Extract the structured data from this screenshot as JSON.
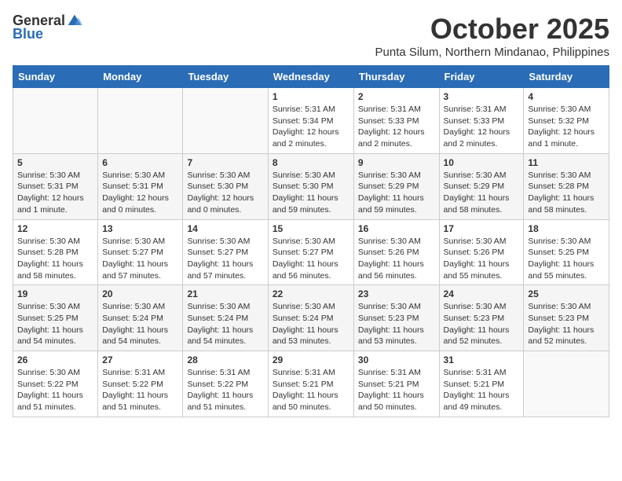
{
  "logo": {
    "general": "General",
    "blue": "Blue"
  },
  "title": "October 2025",
  "subtitle": "Punta Silum, Northern Mindanao, Philippines",
  "days_of_week": [
    "Sunday",
    "Monday",
    "Tuesday",
    "Wednesday",
    "Thursday",
    "Friday",
    "Saturday"
  ],
  "weeks": [
    [
      {
        "day": "",
        "info": ""
      },
      {
        "day": "",
        "info": ""
      },
      {
        "day": "",
        "info": ""
      },
      {
        "day": "1",
        "info": "Sunrise: 5:31 AM\nSunset: 5:34 PM\nDaylight: 12 hours and 2 minutes."
      },
      {
        "day": "2",
        "info": "Sunrise: 5:31 AM\nSunset: 5:33 PM\nDaylight: 12 hours and 2 minutes."
      },
      {
        "day": "3",
        "info": "Sunrise: 5:31 AM\nSunset: 5:33 PM\nDaylight: 12 hours and 2 minutes."
      },
      {
        "day": "4",
        "info": "Sunrise: 5:30 AM\nSunset: 5:32 PM\nDaylight: 12 hours and 1 minute."
      }
    ],
    [
      {
        "day": "5",
        "info": "Sunrise: 5:30 AM\nSunset: 5:31 PM\nDaylight: 12 hours and 1 minute."
      },
      {
        "day": "6",
        "info": "Sunrise: 5:30 AM\nSunset: 5:31 PM\nDaylight: 12 hours and 0 minutes."
      },
      {
        "day": "7",
        "info": "Sunrise: 5:30 AM\nSunset: 5:30 PM\nDaylight: 12 hours and 0 minutes."
      },
      {
        "day": "8",
        "info": "Sunrise: 5:30 AM\nSunset: 5:30 PM\nDaylight: 11 hours and 59 minutes."
      },
      {
        "day": "9",
        "info": "Sunrise: 5:30 AM\nSunset: 5:29 PM\nDaylight: 11 hours and 59 minutes."
      },
      {
        "day": "10",
        "info": "Sunrise: 5:30 AM\nSunset: 5:29 PM\nDaylight: 11 hours and 58 minutes."
      },
      {
        "day": "11",
        "info": "Sunrise: 5:30 AM\nSunset: 5:28 PM\nDaylight: 11 hours and 58 minutes."
      }
    ],
    [
      {
        "day": "12",
        "info": "Sunrise: 5:30 AM\nSunset: 5:28 PM\nDaylight: 11 hours and 58 minutes."
      },
      {
        "day": "13",
        "info": "Sunrise: 5:30 AM\nSunset: 5:27 PM\nDaylight: 11 hours and 57 minutes."
      },
      {
        "day": "14",
        "info": "Sunrise: 5:30 AM\nSunset: 5:27 PM\nDaylight: 11 hours and 57 minutes."
      },
      {
        "day": "15",
        "info": "Sunrise: 5:30 AM\nSunset: 5:27 PM\nDaylight: 11 hours and 56 minutes."
      },
      {
        "day": "16",
        "info": "Sunrise: 5:30 AM\nSunset: 5:26 PM\nDaylight: 11 hours and 56 minutes."
      },
      {
        "day": "17",
        "info": "Sunrise: 5:30 AM\nSunset: 5:26 PM\nDaylight: 11 hours and 55 minutes."
      },
      {
        "day": "18",
        "info": "Sunrise: 5:30 AM\nSunset: 5:25 PM\nDaylight: 11 hours and 55 minutes."
      }
    ],
    [
      {
        "day": "19",
        "info": "Sunrise: 5:30 AM\nSunset: 5:25 PM\nDaylight: 11 hours and 54 minutes."
      },
      {
        "day": "20",
        "info": "Sunrise: 5:30 AM\nSunset: 5:24 PM\nDaylight: 11 hours and 54 minutes."
      },
      {
        "day": "21",
        "info": "Sunrise: 5:30 AM\nSunset: 5:24 PM\nDaylight: 11 hours and 54 minutes."
      },
      {
        "day": "22",
        "info": "Sunrise: 5:30 AM\nSunset: 5:24 PM\nDaylight: 11 hours and 53 minutes."
      },
      {
        "day": "23",
        "info": "Sunrise: 5:30 AM\nSunset: 5:23 PM\nDaylight: 11 hours and 53 minutes."
      },
      {
        "day": "24",
        "info": "Sunrise: 5:30 AM\nSunset: 5:23 PM\nDaylight: 11 hours and 52 minutes."
      },
      {
        "day": "25",
        "info": "Sunrise: 5:30 AM\nSunset: 5:23 PM\nDaylight: 11 hours and 52 minutes."
      }
    ],
    [
      {
        "day": "26",
        "info": "Sunrise: 5:30 AM\nSunset: 5:22 PM\nDaylight: 11 hours and 51 minutes."
      },
      {
        "day": "27",
        "info": "Sunrise: 5:31 AM\nSunset: 5:22 PM\nDaylight: 11 hours and 51 minutes."
      },
      {
        "day": "28",
        "info": "Sunrise: 5:31 AM\nSunset: 5:22 PM\nDaylight: 11 hours and 51 minutes."
      },
      {
        "day": "29",
        "info": "Sunrise: 5:31 AM\nSunset: 5:21 PM\nDaylight: 11 hours and 50 minutes."
      },
      {
        "day": "30",
        "info": "Sunrise: 5:31 AM\nSunset: 5:21 PM\nDaylight: 11 hours and 50 minutes."
      },
      {
        "day": "31",
        "info": "Sunrise: 5:31 AM\nSunset: 5:21 PM\nDaylight: 11 hours and 49 minutes."
      },
      {
        "day": "",
        "info": ""
      }
    ]
  ]
}
